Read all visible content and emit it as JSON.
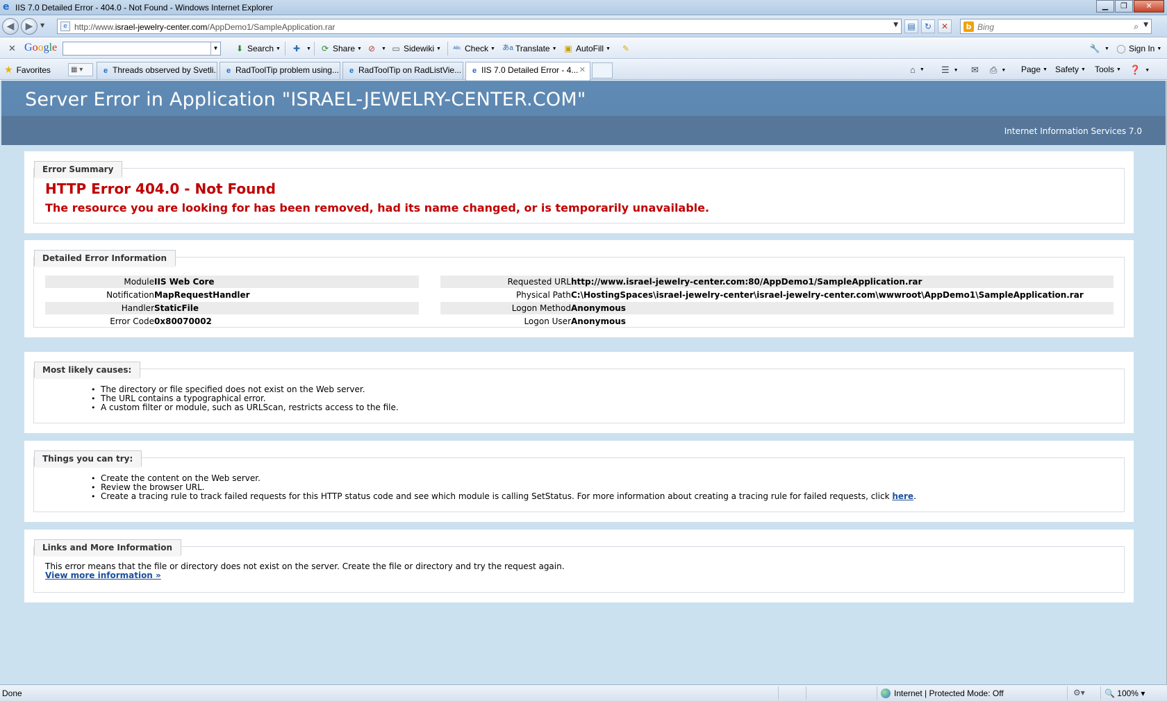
{
  "window": {
    "title": "IIS 7.0 Detailed Error - 404.0 - Not Found - Windows Internet Explorer",
    "minimize": "▁",
    "maximize": "❐",
    "close": "✕"
  },
  "address": {
    "url_prefix": "http://www.",
    "url_host": "israel-jewelry-center.com",
    "url_path": "/AppDemo1/SampleApplication.rar",
    "search_placeholder": "Bing"
  },
  "google_toolbar": {
    "logo": [
      "G",
      "o",
      "o",
      "g",
      "l",
      "e"
    ],
    "search_label": "Search",
    "share_label": "Share",
    "sidewiki_label": "Sidewiki",
    "check_label": "Check",
    "translate_label": "Translate",
    "autofill_label": "AutoFill",
    "signin_label": "Sign In"
  },
  "favorites_bar": {
    "favorites_label": "Favorites",
    "tabs": [
      {
        "label": "Threads observed by Svetli..."
      },
      {
        "label": "RadToolTip problem using..."
      },
      {
        "label": "RadToolTip on RadListVie..."
      },
      {
        "label": "IIS 7.0 Detailed Error - 4..."
      }
    ],
    "page_label": "Page",
    "safety_label": "Safety",
    "tools_label": "Tools"
  },
  "page": {
    "heading": "Server Error in Application \"ISRAEL-JEWELRY-CENTER.COM\"",
    "iis_version": "Internet Information Services 7.0",
    "error_summary": {
      "legend": "Error Summary",
      "title": "HTTP Error 404.0 - Not Found",
      "description": "The resource you are looking for has been removed, had its name changed, or is temporarily unavailable."
    },
    "detailed": {
      "legend": "Detailed Error Information",
      "left": [
        {
          "label": "Module",
          "value": "IIS Web Core"
        },
        {
          "label": "Notification",
          "value": "MapRequestHandler"
        },
        {
          "label": "Handler",
          "value": "StaticFile"
        },
        {
          "label": "Error Code",
          "value": "0x80070002"
        }
      ],
      "right": [
        {
          "label": "Requested URL",
          "value": "http://www.israel-jewelry-center.com:80/AppDemo1/SampleApplication.rar"
        },
        {
          "label": "Physical Path",
          "value": "C:\\HostingSpaces\\israel-jewelry-center\\israel-jewelry-center.com\\wwwroot\\AppDemo1\\SampleApplication.rar"
        },
        {
          "label": "Logon Method",
          "value": "Anonymous"
        },
        {
          "label": "Logon User",
          "value": "Anonymous"
        }
      ]
    },
    "causes": {
      "legend": "Most likely causes:",
      "items": [
        "The directory or file specified does not exist on the Web server.",
        "The URL contains a typographical error.",
        "A custom filter or module, such as URLScan, restricts access to the file."
      ]
    },
    "try": {
      "legend": "Things you can try:",
      "items": [
        "Create the content on the Web server.",
        "Review the browser URL."
      ],
      "tracing_text": "Create a tracing rule to track failed requests for this HTTP status code and see which module is calling SetStatus. For more information about creating a tracing rule for failed requests, click ",
      "tracing_link": "here",
      "tracing_end": "."
    },
    "links": {
      "legend": "Links and More Information",
      "text": "This error means that the file or directory does not exist on the server. Create the file or directory and try the request again.",
      "more_link": "View more information »"
    }
  },
  "status": {
    "done": "Done",
    "zone": "Internet | Protected Mode: Off",
    "zoom": "100%"
  },
  "colors": {
    "header_blue": "#5f8ab4",
    "error_red": "#c00000",
    "page_bg": "#cbe1ef"
  }
}
